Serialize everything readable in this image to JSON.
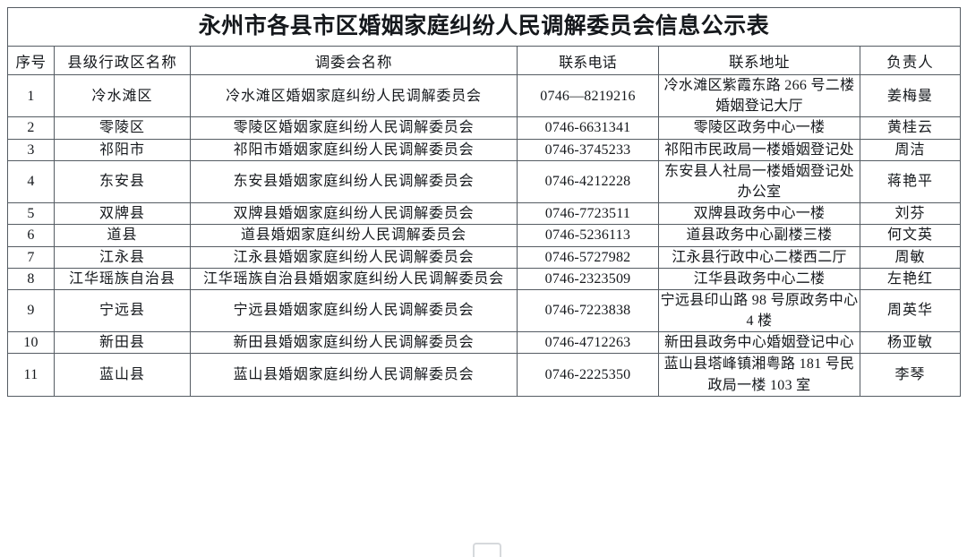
{
  "document": {
    "title": "永州市各县市区婚姻家庭纠纷人民调解委员会信息公示表"
  },
  "table": {
    "headers": {
      "seq": "序号",
      "district": "县级行政区名称",
      "committee": "调委会名称",
      "phone": "联系电话",
      "address": "联系地址",
      "head": "负责人"
    },
    "rows": [
      {
        "seq": "1",
        "district": "冷水滩区",
        "committee": "冷水滩区婚姻家庭纠纷人民调解委员会",
        "phone": "0746—8219216",
        "address": "冷水滩区紫霞东路 266 号二楼婚姻登记大厅",
        "head": "姜梅曼"
      },
      {
        "seq": "2",
        "district": "零陵区",
        "committee": "零陵区婚姻家庭纠纷人民调解委员会",
        "phone": "0746-6631341",
        "address": "零陵区政务中心一楼",
        "head": "黄桂云"
      },
      {
        "seq": "3",
        "district": "祁阳市",
        "committee": "祁阳市婚姻家庭纠纷人民调解委员会",
        "phone": "0746-3745233",
        "address": "祁阳市民政局一楼婚姻登记处",
        "head": "周洁"
      },
      {
        "seq": "4",
        "district": "东安县",
        "committee": "东安县婚姻家庭纠纷人民调解委员会",
        "phone": "0746-4212228",
        "address": "东安县人社局一楼婚姻登记处办公室",
        "head": "蒋艳平"
      },
      {
        "seq": "5",
        "district": "双牌县",
        "committee": "双牌县婚姻家庭纠纷人民调解委员会",
        "phone": "0746-7723511",
        "address": "双牌县政务中心一楼",
        "head": "刘芬"
      },
      {
        "seq": "6",
        "district": "道县",
        "committee": "道县婚姻家庭纠纷人民调解委员会",
        "phone": "0746-5236113",
        "address": "道县政务中心副楼三楼",
        "head": "何文英"
      },
      {
        "seq": "7",
        "district": "江永县",
        "committee": "江永县婚姻家庭纠纷人民调解委员会",
        "phone": "0746-5727982",
        "address": "江永县行政中心二楼西二厅",
        "head": "周敏"
      },
      {
        "seq": "8",
        "district": "江华瑶族自治县",
        "committee": "江华瑶族自治县婚姻家庭纠纷人民调解委员会",
        "phone": "0746-2323509",
        "address": "江华县政务中心二楼",
        "head": "左艳红"
      },
      {
        "seq": "9",
        "district": "宁远县",
        "committee": "宁远县婚姻家庭纠纷人民调解委员会",
        "phone": "0746-7223838",
        "address": "宁远县印山路 98 号原政务中心 4 楼",
        "head": "周英华"
      },
      {
        "seq": "10",
        "district": "新田县",
        "committee": "新田县婚姻家庭纠纷人民调解委员会",
        "phone": "0746-4712263",
        "address": "新田县政务中心婚姻登记中心",
        "head": "杨亚敏"
      },
      {
        "seq": "11",
        "district": "蓝山县",
        "committee": "蓝山县婚姻家庭纠纷人民调解委员会",
        "phone": "0746-2225350",
        "address": "蓝山县塔峰镇湘粤路 181 号民政局一楼 103 室",
        "head": "李琴"
      }
    ]
  }
}
